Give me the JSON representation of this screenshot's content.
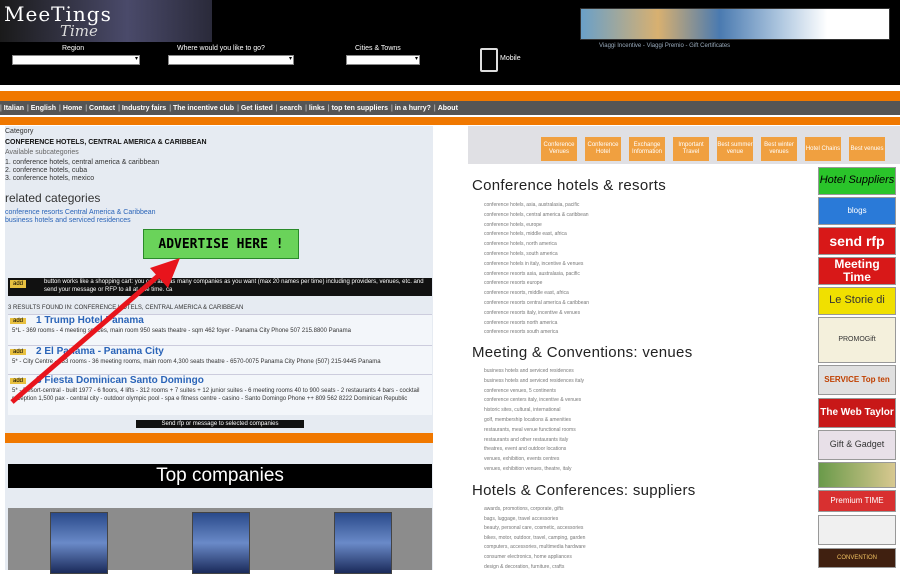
{
  "header": {
    "logo_line1": "MeeTings",
    "logo_line2": "Time",
    "region_label": "Region",
    "where_label": "Where would you like to go?",
    "cities_label": "Cities & Towns",
    "mobile_label": "Mobile",
    "banner_tag": "Viaggi Incentive - Viaggi Premio - Gift Certificates"
  },
  "nav": [
    "Italian",
    "English",
    "Home",
    "Contact",
    "Industry fairs",
    "The incentive club",
    "Get listed",
    "search",
    "links",
    "top ten suppliers",
    "in a hurry?",
    "About"
  ],
  "left": {
    "category_label": "Category",
    "category_title": "CONFERENCE HOTELS, CENTRAL AMERICA & CARIBBEAN",
    "available_sub": "Available subcategories",
    "subcategories": [
      "1. conference hotels, central america & caribbean",
      "2. conference hotels, cuba",
      "3. conference hotels, mexico"
    ],
    "related_title": "related categories",
    "related_links": [
      "conference resorts Central America & Caribbean",
      "business hotels and serviced residences"
    ],
    "advertise": "ADVERTISE HERE !",
    "info_add": "add",
    "info_text": "button works like a shopping cart: you can add as many companies as you want (max 20 names per time) including providers, venues, etc. and send your message or RFP to all at one time. ca",
    "results_found": "3 RESULTS FOUND IN: CONFERENCE HOTELS, CENTRAL AMERICA & CARIBBEAN",
    "results": [
      {
        "add": "add",
        "title": "1  Trump Hotel Panama",
        "desc": "5*L - 369 rooms - 4 meeting spaces, main room 950 seats theatre - sqm 462 foyer - Panama City   Phone 507 215.8800   Panama"
      },
      {
        "add": "add",
        "title": "2  El Panama - Panama City",
        "desc": "5* - City Centre - 333 rooms - 36 meeting rooms, main room 4,300 seats theatre - 6570-0075 Panama City   Phone (507) 215-9445   Panama"
      },
      {
        "add": "add",
        "title": "3  Fiesta Dominican Santo Domingo",
        "desc": "5* - Resort-central - built 1977 - 6 floors, 4 lifts - 312 rooms + 7 suites + 12 junior suites - 6 meeting rooms 40 to 900 seats - 2 restaurants 4 bars - cocktail reception 1,500 pax - central city - outdoor olympic pool - spa e fitness centre - casino -   Santo Domingo   Phone ++ 809 562 8222   Dominican Republic"
      }
    ],
    "send_btn": "Send rfp or message to selected companies",
    "top_companies": "Top companies"
  },
  "right": {
    "buttons": [
      "Conference Venues",
      "Conference Hotel",
      "Exchange Information",
      "Important Travel",
      "Best summer venue",
      "Best winter venues",
      "Hotel Chains",
      "Best venues"
    ],
    "section1_title": "Conference hotels & resorts",
    "section1_items": [
      "conference hotels, asia, australasia, pacific",
      "conference hotels, central america & caribbean",
      "conference hotels, europe",
      "conference hotels, middle east, africa",
      "conference hotels, north america",
      "conference hotels, south america",
      "conference hotels in italy, incentive & venues",
      "conference resorts asia, australasia, pacific",
      "conference resorts europe",
      "conference resorts, middle east, africa",
      "conference resorts central america & caribbean",
      "conference resorts italy, incentive & venues",
      "conference resorts north america",
      "conference resorts south america"
    ],
    "section2_title": "Meeting & Conventions: venues",
    "section2_items": [
      "business hotels and serviced residences",
      "business hotels and serviced residences italy",
      "conference venues, 5 continents",
      "conference centers italy, incentive & venues",
      "historic sites, cultural, international",
      "golf, membership locations & amenities",
      "restaurants, meal venue functional rooms",
      "restaurants and other restaurants italy",
      "theatres, event and outdoor locations",
      "venues, exhibition, events centres",
      "venues, exhibition venues, theatre, italy"
    ],
    "section3_title": "Hotels & Conferences: suppliers",
    "section3_items": [
      "awards, promotions, corporate, gifts",
      "bags, luggage, travel accessories",
      "beauty, personal care, cosmetic, accessories",
      "bikes, motor, outdoor, travel, camping, garden",
      "computers, accessories, multimedia hardware",
      "consumer electronics, home appliances",
      "design & decoration, furniture, crafts"
    ]
  },
  "sidebar": [
    "Hotel Suppliers",
    "blogs",
    "send rfp",
    "Meeting Time",
    "Le Storie di",
    "PROMOGift",
    "SERVICE Top ten",
    "The Web Taylor",
    "Gift & Gadget",
    "Premium TIME",
    "CONVENTION"
  ]
}
